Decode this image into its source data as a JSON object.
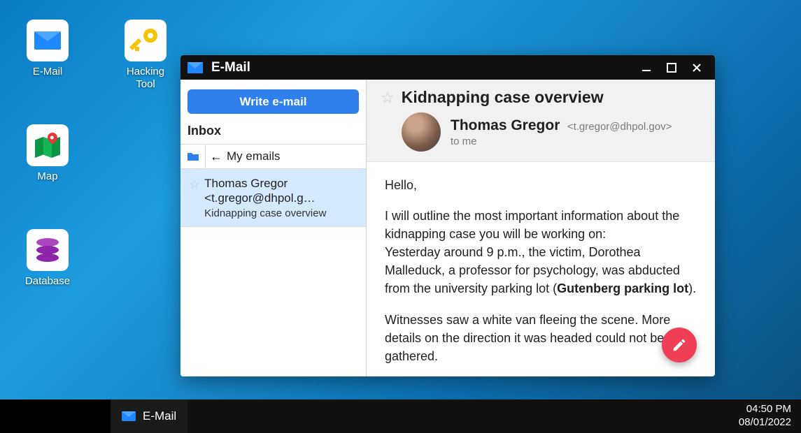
{
  "desktop": {
    "icons": [
      {
        "label": "E-Mail"
      },
      {
        "label": "Hacking\nTool"
      },
      {
        "label": "Map"
      },
      {
        "label": "Database"
      }
    ]
  },
  "window": {
    "title": "E-Mail",
    "compose_label": "Write e-mail",
    "inbox_label": "Inbox",
    "breadcrumb": "My emails",
    "mails": [
      {
        "from_line1": "Thomas Gregor",
        "from_line2": "<t.gregor@dhpol.g…",
        "subject": "Kidnapping case overview"
      }
    ],
    "reader": {
      "subject": "Kidnapping case overview",
      "sender_name": "Thomas Gregor",
      "sender_addr": "<t.gregor@dhpol.gov>",
      "to_line": "to me",
      "greeting": "Hello,",
      "p1_a": "I will outline the most important information about the kidnapping case you will be working on:",
      "p1_b_pre": "Yesterday around 9 p.m., the victim, Dorothea Malleduck, a professor for psychology, was abducted from the university parking lot (",
      "p1_b_bold": "Gutenberg parking lot",
      "p1_b_post": ").",
      "p2": "Witnesses saw a white van fleeing the scene. More details on the direction it was headed could not be gathered."
    }
  },
  "taskbar": {
    "item_label": "E-Mail",
    "time": "04:50 PM",
    "date": "08/01/2022"
  }
}
